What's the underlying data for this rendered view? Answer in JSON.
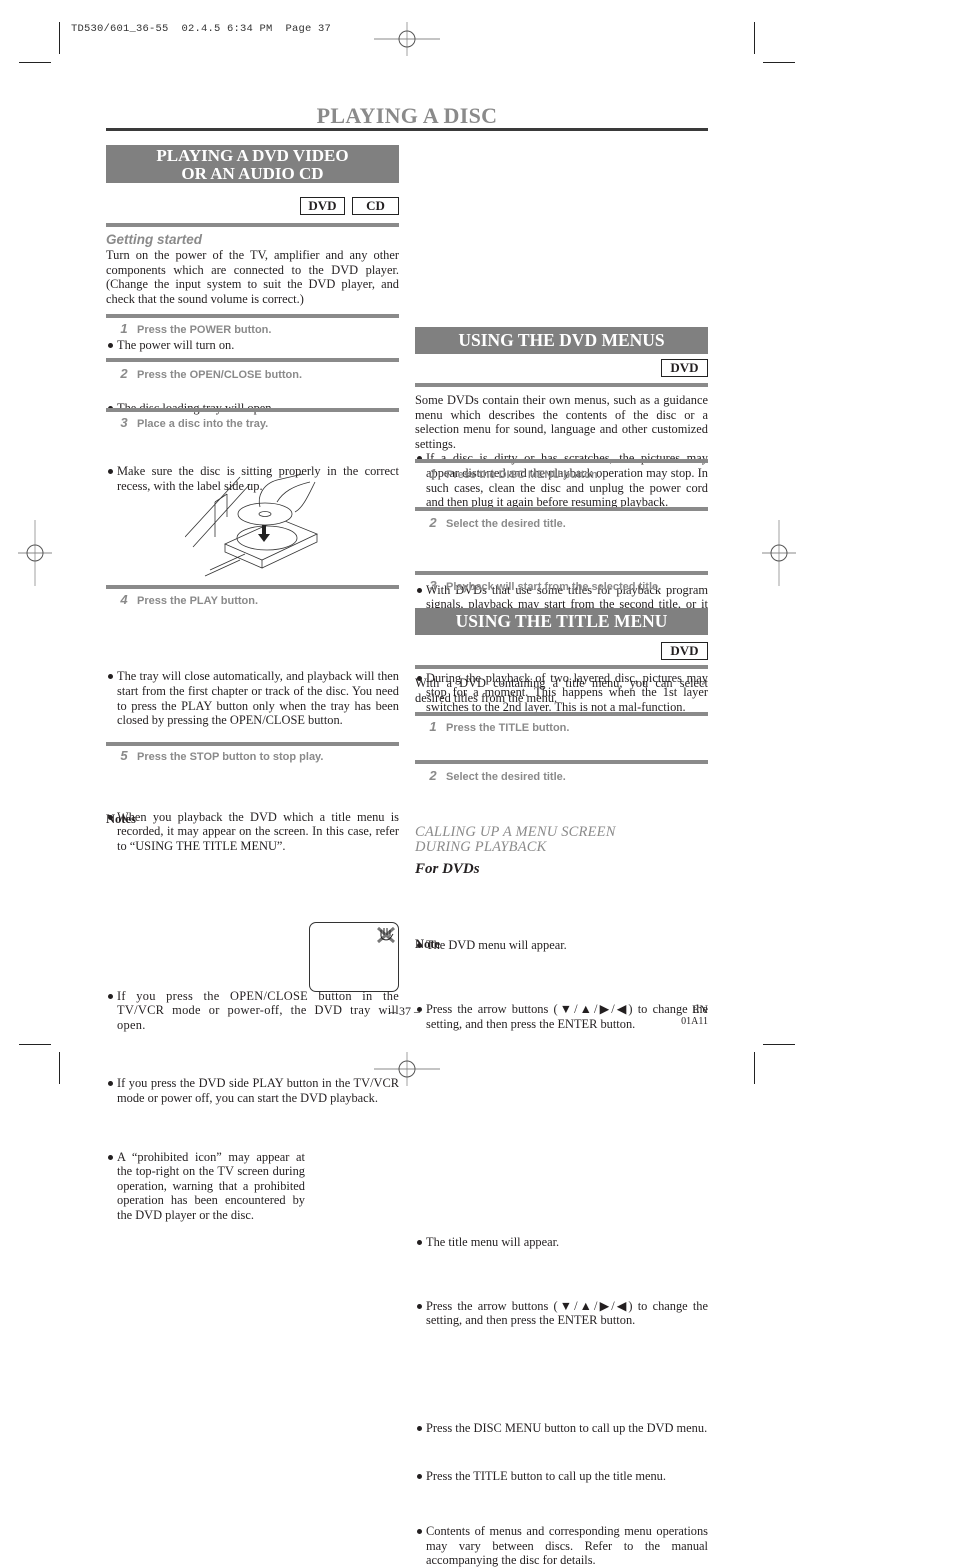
{
  "slug": {
    "text": "TD530/601_36-55  02.4.5 6:34 PM  Page 37"
  },
  "page": {
    "title": "PLAYING A DISC",
    "page_number": "– 37 –",
    "language": "EN",
    "code": "01A11"
  },
  "left": {
    "section_title_line1": "PLAYING A DVD VIDEO",
    "section_title_line2": "OR AN AUDIO CD",
    "badges": [
      "DVD",
      "CD"
    ],
    "getting_started": {
      "heading": "Getting started",
      "text": "Turn on the power of the TV, amplifier and any other components which are connected to the DVD player. (Change the input system to suit the DVD player, and check that the sound volume is correct.)"
    },
    "steps": [
      {
        "num": "1",
        "label": "Press the POWER button.",
        "bullets": [
          "The power will turn on."
        ]
      },
      {
        "num": "2",
        "label": "Press the OPEN/CLOSE button.",
        "bullets": [
          "The disc loading tray will open."
        ]
      },
      {
        "num": "3",
        "label": "Place a disc into the tray.",
        "bullets": [
          "Make sure the disc is sitting properly in the correct recess, with the label side up."
        ]
      },
      {
        "num": "4",
        "label": "Press the PLAY button.",
        "bullets": [
          "The tray will close automatically, and playback will then start from the first chapter or track of the disc. You need to press the PLAY button only when the tray has been closed by pressing the OPEN/CLOSE button.",
          "When you playback the DVD which a title menu is recorded, it may appear on the screen. In this case, refer to “USING THE TITLE MENU”."
        ]
      },
      {
        "num": "5",
        "label": "Press the STOP button to stop play.",
        "bullets": []
      }
    ],
    "illustration": "disc-tray-illustration",
    "notes": {
      "heading": "Notes",
      "items": [
        "If you press the OPEN/CLOSE button in the TV/VCR mode or power-off, the DVD tray will open.",
        "If you press the DVD side PLAY button in the TV/VCR mode or power off, you can start the DVD playback.",
        "A “prohibited icon” may appear at the top-right on the TV screen during operation, warning that a prohibited operation has been encountered by the DVD player or the disc."
      ],
      "screen_icon": "prohibited-hand-icon"
    }
  },
  "right": {
    "top_bullets": [
      "If a disc is dirty or has scratches, the pictures may appear distorted and the playback operation may stop. In such cases, clean the disc and unplug the power cord and then plug it again before resuming playback.",
      "With DVDs that use some titles for playback program signals, playback may start from the second title, or it may skip these titles.",
      "During the playback of two layered disc, pictures may stop for a moment. This happens when the 1st layer switches to the 2nd layer. This is not a mal-function."
    ],
    "dvd_menus": {
      "title": "USING THE DVD MENUS",
      "badge": "DVD",
      "intro": "Some DVDs contain their own menus, such as a guidance menu which describes the contents of the disc or a selection menu for sound, language and other customized settings.",
      "steps": [
        {
          "num": "1",
          "label": "Press the DISC MENU button.",
          "bullets": [
            "The DVD menu will appear."
          ]
        },
        {
          "num": "2",
          "label": "Select the desired title.",
          "bullets": [
            "Press the arrow buttons (▼/▲/▶/◀) to change the setting, and then press the ENTER button."
          ]
        },
        {
          "num": "3",
          "label": "Playback will start from the selected title.",
          "bullets": []
        }
      ]
    },
    "title_menu": {
      "title": "USING THE TITLE MENU",
      "badge": "DVD",
      "intro": "With a DVD containing a title menu, you can select desired titles from the menu.",
      "steps": [
        {
          "num": "1",
          "label": "Press the TITLE button.",
          "bullets": [
            "The title menu will appear."
          ]
        },
        {
          "num": "2",
          "label": "Select the desired title.",
          "bullets": [
            "Press the arrow buttons (▼/▲/▶/◀) to change the setting, and then press the ENTER button."
          ]
        }
      ]
    },
    "calling_up": {
      "heading_line1": "CALLING UP A MENU SCREEN",
      "heading_line2": "DURING PLAYBACK",
      "for_dvds": "For DVDs",
      "bullets": [
        "Press the DISC MENU button to call up the DVD menu.",
        "Press the TITLE button to call up the title menu."
      ],
      "note_heading": "Note",
      "note_bullets": [
        "Contents of menus and corresponding menu operations may vary between discs. Refer to the manual accompanying the disc for details."
      ]
    }
  }
}
